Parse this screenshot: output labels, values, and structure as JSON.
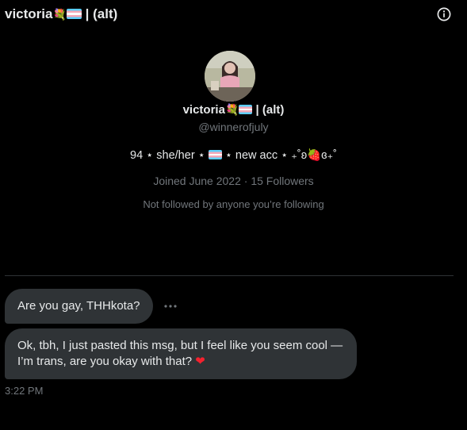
{
  "header": {
    "name": "victoria",
    "alt_suffix": "| (alt)",
    "info_icon": "info-icon"
  },
  "profile": {
    "name": "victoria",
    "alt_suffix": "| (alt)",
    "handle": "@winnerofjuly",
    "bio_prefix": "94 ⋆ she/her ⋆",
    "bio_suffix": "⋆ new acc ⋆ ₊˚ʚ🍓ɞ₊˚",
    "joined": "Joined June 2022",
    "separator": "·",
    "followers": "15 Followers",
    "followed_by": "Not followed by anyone you’re following"
  },
  "messages": [
    {
      "text": "Are you gay, THHkota?"
    },
    {
      "text": "Ok, tbh, I just pasted this msg, but I feel like you seem cool — I’m trans, are you okay with that?",
      "emoji": "❤"
    }
  ],
  "timestamp": "3:22 PM",
  "colors": {
    "background": "#000000",
    "bubble": "#2f3336",
    "secondary_text": "#71767b",
    "primary_text": "#e7e9ea",
    "heart": "#f4212e"
  }
}
